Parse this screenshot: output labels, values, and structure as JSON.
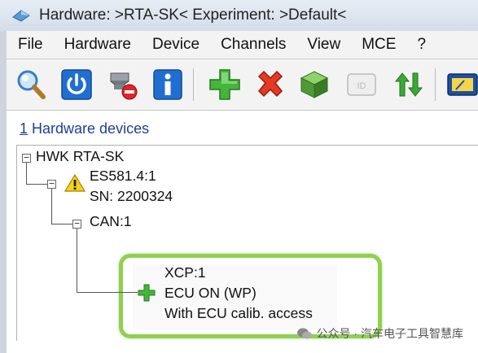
{
  "window": {
    "title": "Hardware: >RTA-SK<   Experiment: >Default<"
  },
  "menu": {
    "items": [
      "File",
      "Hardware",
      "Device",
      "Channels",
      "View",
      "MCE",
      "?"
    ]
  },
  "toolbar": {
    "icons": [
      "search-icon",
      "power-icon",
      "remove-hardware-icon",
      "info-icon",
      "add-icon",
      "delete-icon",
      "cube-icon",
      "id-card-icon",
      "sort-arrows-icon",
      "gauge-icon"
    ]
  },
  "panel": {
    "number": "1",
    "title": " Hardware devices"
  },
  "tree": {
    "root": "HWK RTA-SK",
    "device_name": "ES581.4:1",
    "device_sn": "SN: 2200324",
    "channel": "CAN:1",
    "protocol": "XCP:1",
    "ecu_status": "ECU ON (WP)",
    "ecu_access": "With ECU calib. access"
  },
  "watermark": {
    "text": "公众号 · 汽车电子工具智慧库"
  },
  "colors": {
    "highlight": "#8fd14f",
    "link_blue": "#1f3f99"
  }
}
